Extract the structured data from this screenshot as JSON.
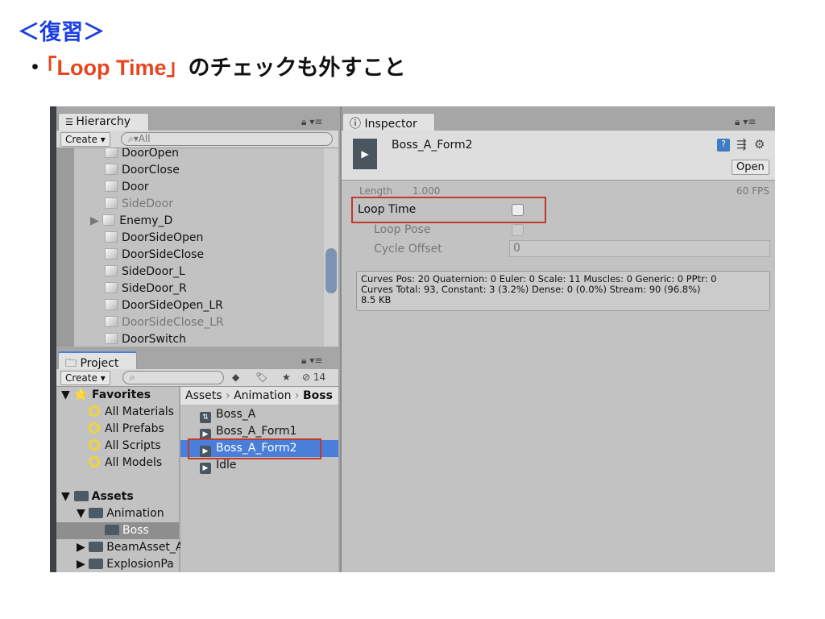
{
  "slide": {
    "title": "＜復習＞",
    "bullet_prefix": "・",
    "bullet_highlight": "「Loop Time」",
    "bullet_suffix": "のチェックも外すこと"
  },
  "colors": {
    "title": "#1a3fe0",
    "highlight": "#e8451e",
    "selection": "#4a7fd9",
    "annotation_box": "#c0392b"
  },
  "hierarchy": {
    "tab": "Hierarchy",
    "create": "Create ▾",
    "search_placeholder": "All",
    "items": [
      {
        "label": "DoorOpen",
        "dim": false
      },
      {
        "label": "DoorClose",
        "dim": false
      },
      {
        "label": "Door",
        "dim": false
      },
      {
        "label": "SideDoor",
        "dim": true
      },
      {
        "label": "Enemy_D",
        "dim": false,
        "expandable": true
      },
      {
        "label": "DoorSideOpen",
        "dim": false
      },
      {
        "label": "DoorSideClose",
        "dim": false
      },
      {
        "label": "SideDoor_L",
        "dim": false
      },
      {
        "label": "SideDoor_R",
        "dim": false
      },
      {
        "label": "DoorSideOpen_LR",
        "dim": false
      },
      {
        "label": "DoorSideClose_LR",
        "dim": true
      },
      {
        "label": "DoorSwitch",
        "dim": false
      }
    ]
  },
  "project": {
    "tab": "Project",
    "create": "Create ▾",
    "hidden_count": "14",
    "favorites": "Favorites",
    "favorite_items": [
      "All Materials",
      "All Prefabs",
      "All Scripts",
      "All Models"
    ],
    "assets": "Assets",
    "animation": "Animation",
    "boss": "Boss",
    "beam": "BeamAsset_A",
    "explosion": "ExplosionPa",
    "breadcrumb": [
      "Assets",
      "Animation",
      "Boss"
    ],
    "files": [
      {
        "label": "Boss_A",
        "icon": "animator-controller-icon"
      },
      {
        "label": "Boss_A_Form1",
        "icon": "animation-clip-icon"
      },
      {
        "label": "Boss_A_Form2",
        "icon": "animation-clip-icon",
        "selected": true
      },
      {
        "label": "Idle",
        "icon": "animation-clip-icon"
      }
    ]
  },
  "inspector": {
    "tab": "Inspector",
    "asset_name": "Boss_A_Form2",
    "open": "Open",
    "length_label": "Length",
    "length_value": "1.000",
    "fps": "60 FPS",
    "loop_time": "Loop Time",
    "loop_time_checked": false,
    "loop_pose": "Loop Pose",
    "loop_pose_checked": false,
    "cycle_offset": "Cycle Offset",
    "cycle_offset_value": "0",
    "info": [
      "Curves Pos: 20 Quaternion: 0 Euler: 0 Scale: 11 Muscles: 0 Generic: 0 PPtr: 0",
      "Curves Total: 93, Constant: 3 (3.2%) Dense: 0 (0.0%) Stream: 90 (96.8%)",
      "8.5 KB"
    ]
  }
}
